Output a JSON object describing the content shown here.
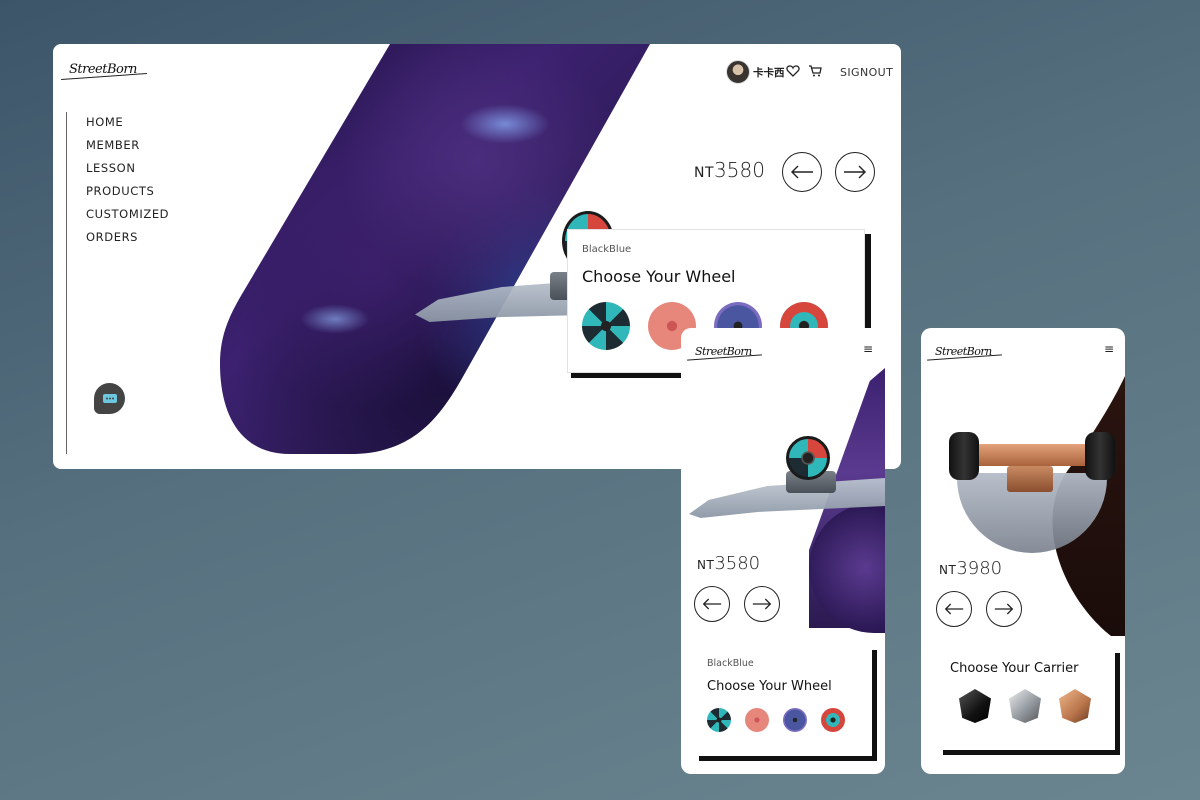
{
  "brand": {
    "logo_text": "StreetBorn"
  },
  "desktop": {
    "nav": [
      "HOME",
      "MEMBER",
      "LESSON",
      "PRODUCTS",
      "CUSTOMIZED",
      "ORDERS"
    ],
    "user": {
      "name": "卡卡西"
    },
    "signout_label": "SIGNOUT",
    "price": {
      "currency": "NT",
      "amount": "3580"
    },
    "panel": {
      "subtitle": "BlackBlue",
      "title": "Choose Your Wheel"
    },
    "wheels": [
      "black-blue-wheel",
      "salmon-wheel",
      "purple-wheel",
      "black-red-wheel"
    ]
  },
  "mobile_wheel": {
    "price": {
      "currency": "NT",
      "amount": "3580"
    },
    "panel": {
      "subtitle": "BlackBlue",
      "title": "Choose Your Wheel"
    },
    "wheels": [
      "black-blue-wheel",
      "salmon-wheel",
      "purple-wheel",
      "black-red-wheel"
    ]
  },
  "mobile_carrier": {
    "price": {
      "currency": "NT",
      "amount": "3980"
    },
    "panel": {
      "title": "Choose Your Carrier"
    },
    "carriers": [
      "black-carrier",
      "silver-carrier",
      "copper-carrier"
    ]
  },
  "icons": [
    "heart-icon",
    "cart-icon",
    "arrow-left-icon",
    "arrow-right-icon",
    "chat-icon",
    "menu-icon"
  ],
  "colors": {
    "accent_purple": "#3c2170",
    "copper": "#b8744a",
    "text": "#222222"
  }
}
